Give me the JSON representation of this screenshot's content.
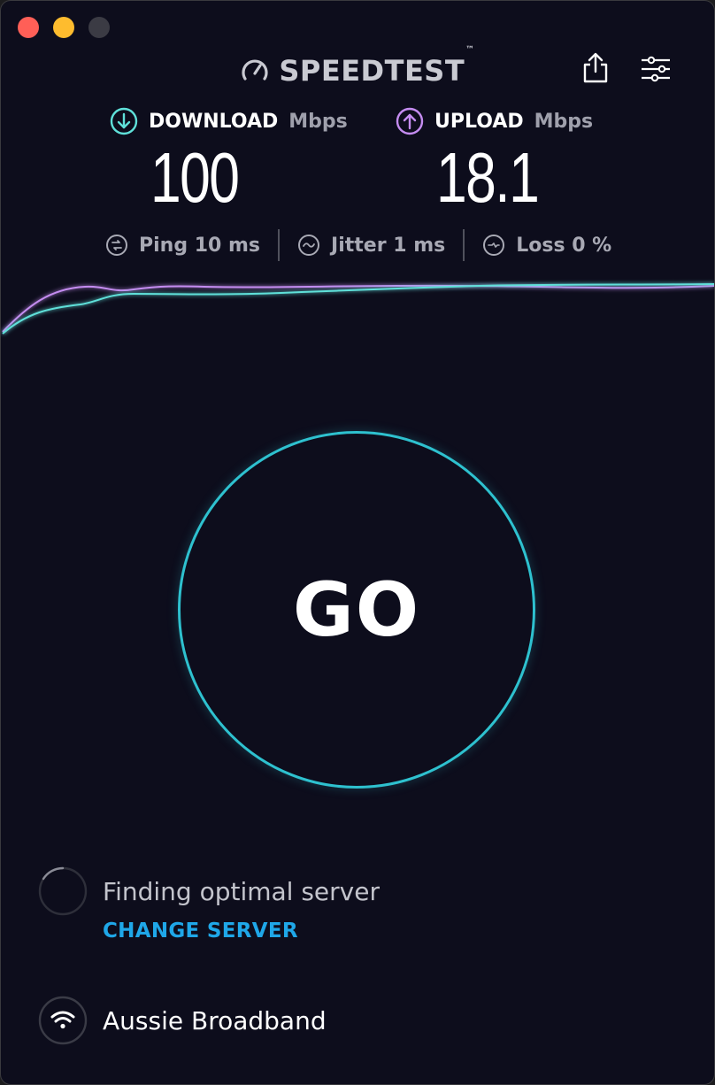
{
  "window": {
    "traffic_lights": [
      "close",
      "minimize",
      "zoom"
    ]
  },
  "header": {
    "brand": "SPEEDTEST",
    "brand_mark": "™",
    "icons": [
      "speed-gauge-icon",
      "share-icon",
      "settings-sliders-icon"
    ]
  },
  "metrics": {
    "download": {
      "label": "DOWNLOAD",
      "unit": "Mbps",
      "value": "100",
      "icon": "download-arrow-icon",
      "color": "#5fe0d9"
    },
    "upload": {
      "label": "UPLOAD",
      "unit": "Mbps",
      "value": "18.1",
      "icon": "upload-arrow-icon",
      "color": "#c48cf0"
    }
  },
  "stats": [
    {
      "label": "Ping 10 ms",
      "icon": "ping-icon"
    },
    {
      "label": "Jitter 1 ms",
      "icon": "jitter-icon"
    },
    {
      "label": "Loss 0 %",
      "icon": "loss-icon"
    }
  ],
  "go_button": {
    "label": "GO",
    "ring_color": "#2ec1cf"
  },
  "server": {
    "status": "Finding optimal server",
    "change_label": "CHANGE SERVER",
    "accent": "#1fa7e8"
  },
  "isp": {
    "name": "Aussie Broadband",
    "icon": "wifi-icon"
  },
  "colors": {
    "background": "#0d0d1c",
    "download_line": "#5fe0d9",
    "upload_line": "#c48cf0"
  }
}
